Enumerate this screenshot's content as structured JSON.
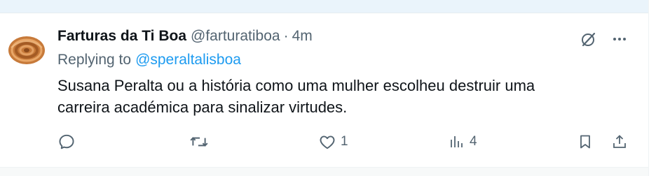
{
  "tweet": {
    "author": {
      "display_name": "Farturas da Ti Boa",
      "handle": "@farturatiboa",
      "separator": "·",
      "timestamp": "4m",
      "avatar_icon": "churro-spiral-avatar"
    },
    "reply": {
      "prefix": "Replying to",
      "mention": "@speraltalisboa"
    },
    "text_lines": [
      "Susana Peralta ou a história como uma mulher escolheu destruir uma",
      "carreira académica para sinalizar virtudes."
    ],
    "actions": {
      "reply": {
        "icon": "reply-icon",
        "count": ""
      },
      "retweet": {
        "icon": "retweet-icon",
        "count": ""
      },
      "like": {
        "icon": "heart-icon",
        "count": "1"
      },
      "views": {
        "icon": "views-icon",
        "count": "4"
      },
      "bookmark": {
        "icon": "bookmark-icon"
      },
      "share": {
        "icon": "share-icon"
      }
    },
    "top_controls": {
      "grok": {
        "icon": "grok-icon"
      },
      "more": {
        "icon": "more-icon"
      }
    }
  },
  "colors": {
    "text_primary": "#0f1419",
    "text_secondary": "#536471",
    "accent": "#1d9bf0",
    "top_strip": "#eaf4fb"
  }
}
